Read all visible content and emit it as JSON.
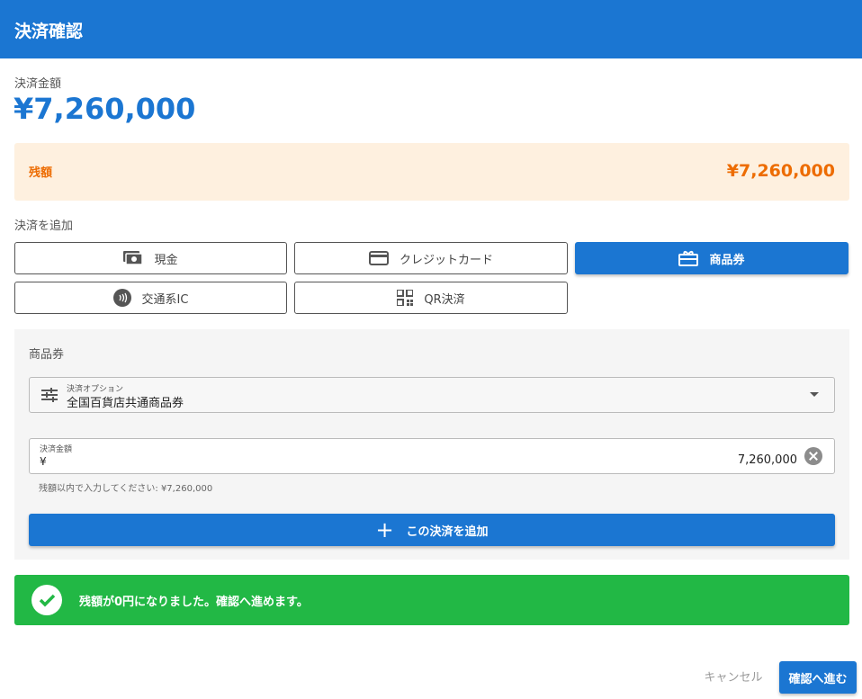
{
  "dialog": {
    "title": "決済確認"
  },
  "payment": {
    "amount_label": "決済金額",
    "amount_value": "¥7,260,000"
  },
  "remaining": {
    "label": "残額",
    "value": "¥7,260,000"
  },
  "add_section": {
    "label": "決済を追加",
    "methods": [
      {
        "label": "現金",
        "icon": "cash-icon",
        "selected": false
      },
      {
        "label": "クレジットカード",
        "icon": "credit-card-icon",
        "selected": false
      },
      {
        "label": "商品券",
        "icon": "gift-card-icon",
        "selected": true
      },
      {
        "label": "交通系IC",
        "icon": "contactless-icon",
        "selected": false
      },
      {
        "label": "QR決済",
        "icon": "qr-code-icon",
        "selected": false
      }
    ]
  },
  "panel": {
    "title": "商品券",
    "option_select": {
      "label": "決済オプション",
      "value": "全国百貨店共通商品券",
      "icon": "tune-icon"
    },
    "amount_field": {
      "label": "決済金額",
      "currency": "¥",
      "value": "7,260,000",
      "icon": "clear-icon"
    },
    "helper_text": "残額以内で入力してください: ¥7,260,000",
    "add_button": {
      "label": "この決済を追加",
      "icon": "plus-icon"
    }
  },
  "success_alert": {
    "message": "残額が0円になりました。確認へ進めます。",
    "icon": "check-circle-icon"
  },
  "footer": {
    "cancel_label": "キャンセル",
    "confirm_label": "確認へ進む"
  },
  "colors": {
    "primary": "#1b76d2",
    "warning_bg": "#fef0df",
    "warning_text": "#ed6c02",
    "success": "#22b845"
  }
}
